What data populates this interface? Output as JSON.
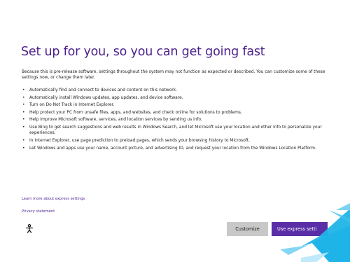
{
  "setup": {
    "title": "Set up for you, so you can get going fast",
    "intro": "Because this is pre-release software, settings throughout the system may not function as expected or described. You can customize some of these settings now, or change them later.",
    "bullet_glyph": "•",
    "bullets": [
      "Automatically find and connect to devices and content on this network.",
      "Automatically install Windows updates, app updates, and device software.",
      "Turn on Do Not Track in Internet Explorer.",
      "Help protect your PC from unsafe files, apps, and websites, and check online for solutions to problems.",
      "Help improve Microsoft software, services, and location services by sending us info.",
      "Use Bing to get search suggestions and web results in Windows Search, and let Microsoft use your location and other info to personalize your experiences.",
      "In Internet Explorer, use page prediction to preload pages, which sends your browsing history to Microsoft.",
      "Let Windows and apps use your name, account picture, and advertising ID, and request your location from the Windows Location Platform."
    ],
    "links": {
      "learn_more": "Learn more about express settings",
      "privacy": "Privacy statement"
    },
    "buttons": {
      "customize": "Customize",
      "express": "Use express setti"
    },
    "icons": {
      "ease_of_access": "ease-of-access-icon"
    },
    "colors": {
      "accent": "#4b1e8c",
      "button_primary": "#5a2ea6",
      "button_secondary": "#c8c8c8",
      "decor_cyan": "#1fb4e8"
    }
  }
}
